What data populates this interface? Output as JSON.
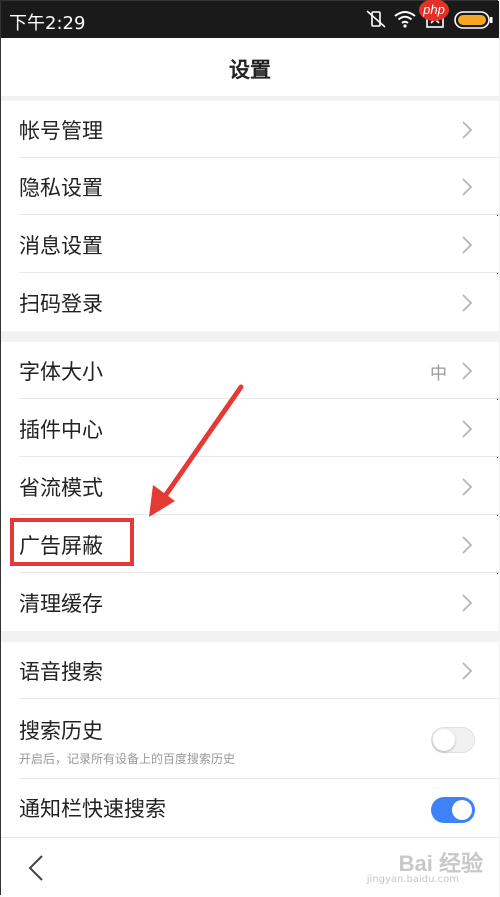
{
  "status_bar": {
    "time": "下午2:29",
    "watermark_badge": "php"
  },
  "header": {
    "title": "设置"
  },
  "groups": [
    {
      "items": [
        {
          "label": "帐号管理"
        },
        {
          "label": "隐私设置"
        },
        {
          "label": "消息设置"
        },
        {
          "label": "扫码登录"
        }
      ]
    },
    {
      "items": [
        {
          "label": "字体大小",
          "value": "中"
        },
        {
          "label": "插件中心"
        },
        {
          "label": "省流模式"
        },
        {
          "label": "广告屏蔽"
        },
        {
          "label": "清理缓存"
        }
      ]
    },
    {
      "items": [
        {
          "label": "语音搜索"
        },
        {
          "label": "搜索历史",
          "subtitle": "开启后，记录所有设备上的百度搜索历史",
          "toggle": false
        },
        {
          "label": "通知栏快速搜索",
          "toggle": true
        }
      ]
    }
  ],
  "footer": {
    "watermark": "Bai 经验",
    "watermark_sub": "jingyan.baidu.com"
  },
  "colors": {
    "accent": "#3e82f7",
    "highlight": "#e53935",
    "status_bar_bg": "#1a1a1a"
  }
}
